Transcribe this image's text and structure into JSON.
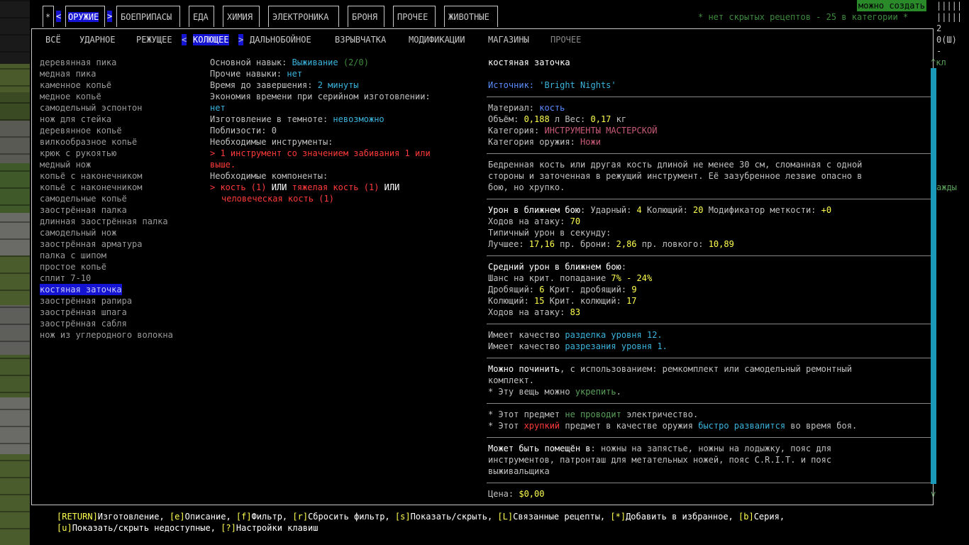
{
  "tabs": [
    {
      "label": "*",
      "selected": false
    },
    {
      "label": "ОРУЖИЕ",
      "selected": true
    },
    {
      "label": "БОЕПРИПАСЫ",
      "selected": false
    },
    {
      "label": "ЕДА",
      "selected": false
    },
    {
      "label": "ХИМИЯ",
      "selected": false
    },
    {
      "label": "ЭЛЕКТРОНИКА",
      "selected": false
    },
    {
      "label": "БРОНЯ",
      "selected": false
    },
    {
      "label": "ПРОЧЕЕ",
      "selected": false
    },
    {
      "label": "ЖИВОТНЫЕ",
      "selected": false
    }
  ],
  "arrows": {
    "left": "<",
    "right": ">"
  },
  "header_info": "* нет скрытых рецептов - 25 в категории *",
  "side_right": {
    "craftable": "можно создать",
    "bars1": "|||||",
    "bars2": "|||||",
    "num": "2",
    "shots": "0(Ш)",
    "dash": "-",
    "up_label": "^кл",
    "mid_label": "ажды",
    "down": "v"
  },
  "subtabs": [
    {
      "label": "ВСЁ",
      "selected": false,
      "dim": false
    },
    {
      "label": "УДАРНОЕ",
      "selected": false,
      "dim": false
    },
    {
      "label": "РЕЖУЩЕЕ",
      "selected": false,
      "dim": false
    },
    {
      "label": "КОЛЮЩЕЕ",
      "selected": true,
      "dim": false
    },
    {
      "label": "ДАЛЬНОБОЙНОЕ",
      "selected": false,
      "dim": false
    },
    {
      "label": "ВЗРЫВЧАТКА",
      "selected": false,
      "dim": false
    },
    {
      "label": "МОДИФИКАЦИИ",
      "selected": false,
      "dim": false
    },
    {
      "label": "МАГАЗИНЫ",
      "selected": false,
      "dim": false
    },
    {
      "label": "ПРОЧЕЕ",
      "selected": false,
      "dim": true
    }
  ],
  "recipes": [
    "деревянная пика",
    "медная пика",
    "каменное копьё",
    "медное копьё",
    "самодельный эспонтон",
    "нож для стейка",
    "деревянное копьё",
    "вилкообразное копьё",
    "крюк с рукоятью",
    "медный нож",
    "копьё с наконечником",
    "копьё с наконечником",
    "самодельные копьё",
    "заострённая палка",
    "длинная заострённая палка",
    "самодельный нож",
    "заострённая арматура",
    "палка с шипом",
    "простое копьё",
    "сплит 7-10",
    "костяная заточка",
    "заострённая рапира",
    "заострённая шпага",
    "заострённая сабля",
    "нож из углеродного волокна"
  ],
  "selected_index": 20,
  "details": {
    "primary_skill_label": "Основной навык: ",
    "primary_skill": "Выживание",
    "primary_skill_level": " (2/0)",
    "other_skills_label": "Прочие навыки: ",
    "other_skills": "нет",
    "time_label": "Время до завершения: ",
    "time": "2 минуты",
    "batch_label": "Экономия времени при серийном изготовлении:",
    "batch": "нет",
    "dark_label": "Изготовление в темноте: ",
    "dark": "невозможно",
    "nearby_label": "Поблизости: ",
    "nearby": "0",
    "tools_label": "Необходимые инструменты:",
    "tool_bullet": "> ",
    "tool_line1": "1 инструмент со значением забивания 1 или",
    "tool_line2": "выше.",
    "components_label": "Необходимые компоненты:",
    "comp_bullet": "> ",
    "comp1": "кость (1)",
    "or1": " ИЛИ ",
    "comp2": "тяжелая кость (1)",
    "or2": " ИЛИ",
    "comp3": "человеческая кость (1)"
  },
  "item": {
    "name": "костяная заточка",
    "source_label": "Источник: ",
    "source": "'Bright Nights'",
    "material_label": "Материал: ",
    "material": "кость",
    "volume_label": "Объём: ",
    "volume": "0,188",
    "volume_unit": " л  Вес: ",
    "weight": "0,17",
    "weight_unit": " кг",
    "category_label": "Категория: ",
    "category": "ИНСТРУМЕНТЫ МАСТЕРСКОЙ",
    "weapon_cat_label": "Категория оружия: ",
    "weapon_cat": "Ножи",
    "desc1": "Бедренная кость или другая кость длиной не менее 30 см, сломанная с одной",
    "desc2": "стороны и заточенная в режущий инструмент. Её зазубренное лезвие опасно в",
    "desc3": "бою, но хрупко.",
    "melee_label": "Урон в ближнем бою",
    "bash_label": ": Ударный: ",
    "bash": "4",
    "stab_label": "  Колющий: ",
    "stab": "20",
    "acc_label": "  Модификатор меткости: ",
    "acc": "+0",
    "moves_label": "Ходов на атаку: ",
    "moves": "70",
    "dps_label": "Типичный урон в секунду:",
    "best_label": "Лучшее: ",
    "best": "17,16",
    "armor_label": "  пр. брони: ",
    "armor": "2,86",
    "agile_label": "  пр. ловкого: ",
    "agile": "10,89",
    "avg_label": "Средний урон в ближнем бою",
    "avg_colon": ":",
    "crit_label": "Шанс на крит. попадание ",
    "crit": "7% - 24%",
    "crush_label": "Дробящий: ",
    "crush": "6",
    "crit_crush_label": "  Крит. дробящий: ",
    "crit_crush": "9",
    "pierce_label": "Колющий: ",
    "pierce": "15",
    "crit_pierce_label": "  Крит. колющий: ",
    "crit_pierce": "17",
    "moves2_label": "Ходов на атаку: ",
    "moves2": "83",
    "q1_label": "Имеет качество ",
    "q1": "разделка уровня 12",
    "q1_end": ".",
    "q2_label": "Имеет качество ",
    "q2": "разрезания уровня 1",
    "q2_end": ".",
    "repair_label": "Можно починить",
    "repair_text": ", с использованием: ремкомплект или самодельный ремонтный",
    "repair_text2": "комплект.",
    "reinforce_pre": "* Эту вещь можно ",
    "reinforce": "укрепить",
    "reinforce_end": ".",
    "cond_pre": "* Этот предмет ",
    "cond": "не проводит",
    "cond_end": " электричество.",
    "frag_pre": "* Этот ",
    "frag": "хрупкий",
    "frag_mid": " предмет в качестве оружия ",
    "frag_fast": "быстро развалится",
    "frag_end": " во время боя.",
    "holster_label": "Может быть помещён в",
    "holster_text": ": ножны на запястье, ножны на лодыжку, пояс для",
    "holster_text2": "инструментов, патронташ для метательных ножей, пояс C.R.I.T. и пояс",
    "holster_text3": "выживальщика",
    "price_label": "Цена: ",
    "price": "$0,00"
  },
  "footer": {
    "line1": [
      {
        "k": "[RETURN]",
        "t": "Изготовление, "
      },
      {
        "k": "[e]",
        "t": "Описание, "
      },
      {
        "k": "[f]",
        "t": "Фильтр, "
      },
      {
        "k": "[r]",
        "t": "Сбросить фильтр, "
      },
      {
        "k": "[s]",
        "t": "Показать/скрыть, "
      },
      {
        "k": "[L]",
        "t": "Связанные рецепты, "
      },
      {
        "k": "[*]",
        "t": "Добавить в избранное, "
      },
      {
        "k": "[b]",
        "t": "Серия,"
      }
    ],
    "line2": [
      {
        "k": "[u]",
        "t": "Показать/скрыть недоступные, "
      },
      {
        "k": "[?]",
        "t": "Настройки клавиш"
      }
    ]
  }
}
